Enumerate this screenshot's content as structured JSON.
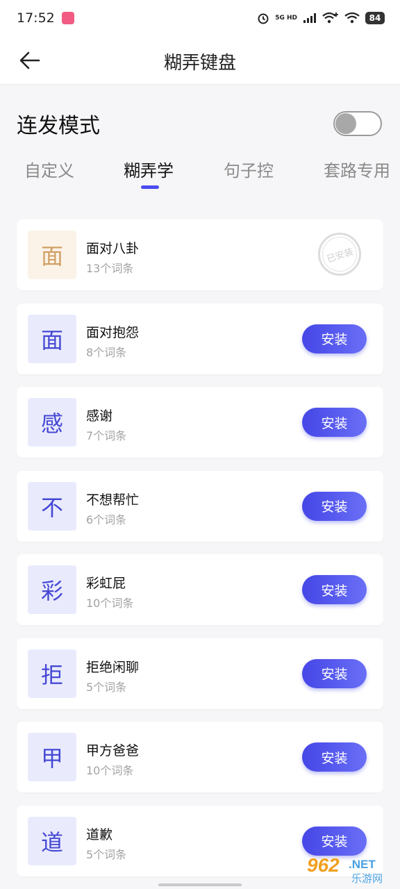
{
  "status_bar": {
    "time": "17:52",
    "network_label": "5G HD",
    "battery": "84"
  },
  "header": {
    "title": "糊弄键盘"
  },
  "mode": {
    "label": "连发模式",
    "enabled": false
  },
  "tabs": [
    {
      "label": "自定义",
      "active": false
    },
    {
      "label": "糊弄学",
      "active": true
    },
    {
      "label": "句子控",
      "active": false
    },
    {
      "label": "套路专用",
      "active": false
    }
  ],
  "items": [
    {
      "char": "面",
      "name": "面对八卦",
      "count": "13个词条",
      "installed": true,
      "status": "已安装"
    },
    {
      "char": "面",
      "name": "面对抱怨",
      "count": "8个词条",
      "installed": false,
      "action": "安装"
    },
    {
      "char": "感",
      "name": "感谢",
      "count": "7个词条",
      "installed": false,
      "action": "安装"
    },
    {
      "char": "不",
      "name": "不想帮忙",
      "count": "6个词条",
      "installed": false,
      "action": "安装"
    },
    {
      "char": "彩",
      "name": "彩虹屁",
      "count": "10个词条",
      "installed": false,
      "action": "安装"
    },
    {
      "char": "拒",
      "name": "拒绝闲聊",
      "count": "5个词条",
      "installed": false,
      "action": "安装"
    },
    {
      "char": "甲",
      "name": "甲方爸爸",
      "count": "10个词条",
      "installed": false,
      "action": "安装"
    },
    {
      "char": "道",
      "name": "道歉",
      "count": "5个词条",
      "installed": false,
      "action": "安装"
    }
  ],
  "watermark": {
    "primary": "962.NET",
    "secondary": "乐游网"
  },
  "colors": {
    "accent": "#4a4cf0",
    "tile_bg": "#e9ebfd",
    "tile_text": "#4648d4",
    "installed_tile_bg": "#fbf3e8",
    "installed_tile_text": "#d1a064"
  }
}
